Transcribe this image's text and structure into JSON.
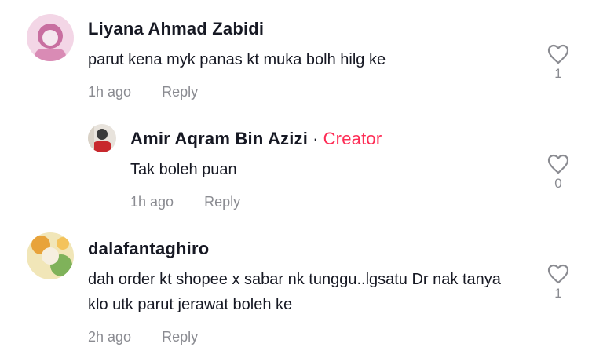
{
  "comments": [
    {
      "username": "Liyana Ahmad Zabidi",
      "text": "parut kena myk panas kt muka bolh hilg ke",
      "time": "1h ago",
      "reply_label": "Reply",
      "likes": "1",
      "avatar_colors": [
        "#f3d6e6",
        "#c86fa0",
        "#f5e8ef"
      ]
    },
    {
      "username": "Amir Aqram Bin Azizi",
      "separator": "·",
      "badge": "Creator",
      "text": "Tak boleh puan",
      "time": "1h ago",
      "reply_label": "Reply",
      "likes": "0",
      "avatar_colors": [
        "#e8e3dc",
        "#c8282d",
        "#3a3a3a"
      ]
    },
    {
      "username": "dalafantaghiro",
      "text": "dah order kt shopee x sabar nk tunggu..lgsatu Dr nak tanya klo utk parut jerawat boleh ke",
      "time": "2h ago",
      "reply_label": "Reply",
      "likes": "1",
      "avatar_colors": [
        "#f1e6b8",
        "#e8a33a",
        "#7fb25a"
      ]
    }
  ],
  "colors": {
    "text": "#161823",
    "muted": "#8a8b91",
    "creator": "#fe2c55",
    "icon": "#8a8b91"
  }
}
